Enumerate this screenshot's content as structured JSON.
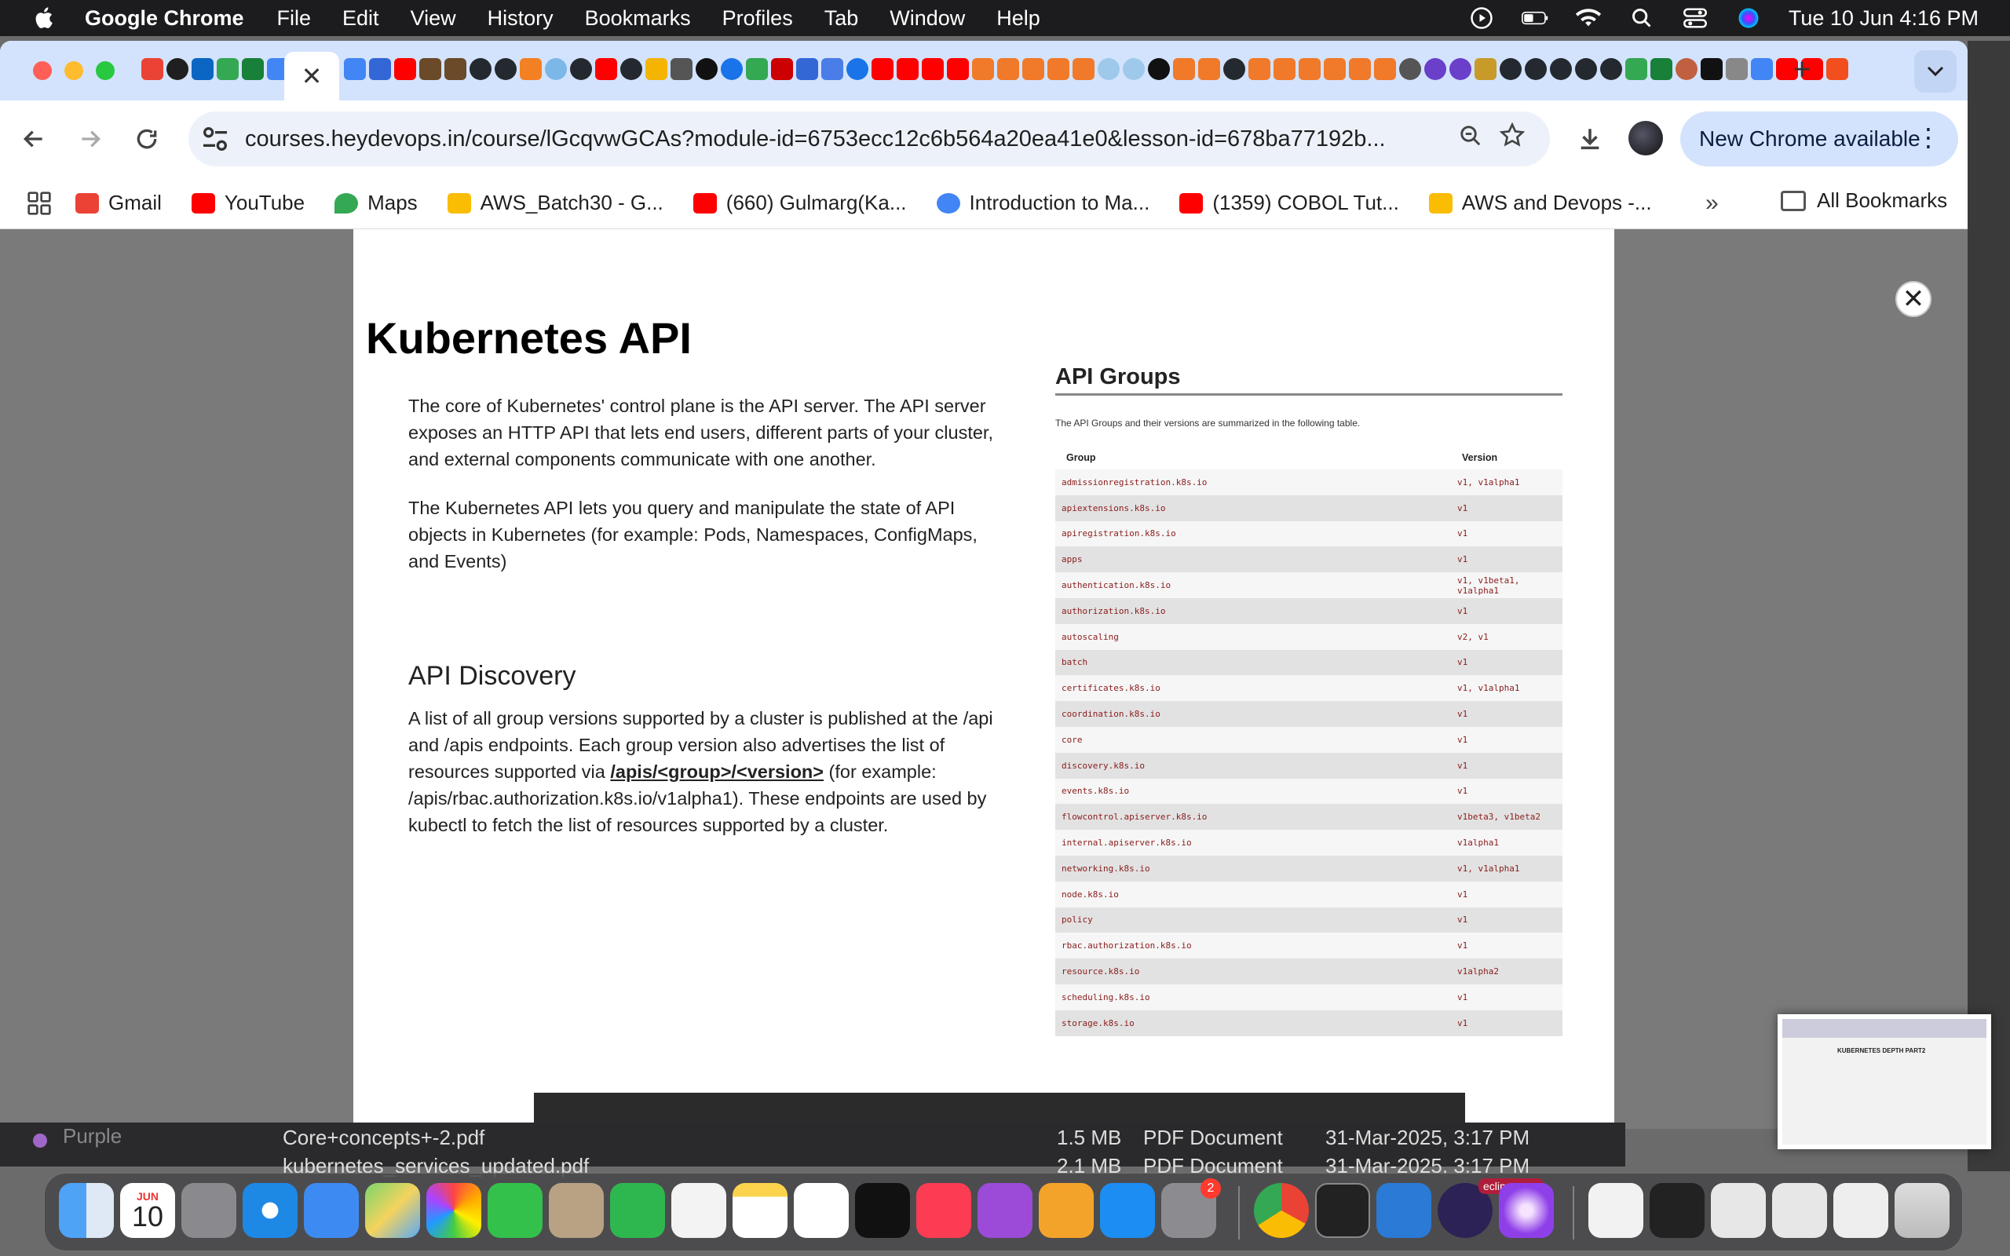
{
  "menubar": {
    "app_name": "Google Chrome",
    "items": [
      "File",
      "Edit",
      "View",
      "History",
      "Bookmarks",
      "Profiles",
      "Tab",
      "Window",
      "Help"
    ],
    "datetime": "Tue 10 Jun  4:16 PM"
  },
  "browser": {
    "active_tab_close": "✕",
    "new_tab": "+",
    "url": "courses.heydevops.in/course/lGcqvwGCAs?module-id=6753ecc12c6b564a20ea41e0&lesson-id=678ba77192b...",
    "update_label": "New Chrome available",
    "bookmarks": [
      {
        "label": "Gmail",
        "color": "#ea4335"
      },
      {
        "label": "YouTube",
        "color": "#ff0000"
      },
      {
        "label": "Maps",
        "color": "#34a853"
      },
      {
        "label": "AWS_Batch30 - G...",
        "color": "#fbbc04"
      },
      {
        "label": "(660) Gulmarg(Ka...",
        "color": "#ff0000"
      },
      {
        "label": "Introduction to Ma...",
        "color": "#4285f4"
      },
      {
        "label": "(1359) COBOL Tut...",
        "color": "#ff0000"
      },
      {
        "label": "AWS and Devops -...",
        "color": "#fbbc04"
      }
    ],
    "all_bookmarks": "All Bookmarks",
    "overflow": "»"
  },
  "slide": {
    "title": "Kubernetes API",
    "p1": "The core of Kubernetes' control plane is the API server. The API server exposes an HTTP API that lets end users, different parts of your cluster, and external components communicate with one another.",
    "p2": "The Kubernetes API lets you query and manipulate the state of API objects in Kubernetes (for example: Pods, Namespaces, ConfigMaps, and Events)",
    "discovery_heading": "API Discovery",
    "p3_before": "A list of all group versions supported by a cluster is published at the /api and /apis endpoints. Each group version also advertises the list of resources supported via ",
    "p3_link": "/apis/<group>/<version>",
    "p3_after": " (for example: /apis/rbac.authorization.k8s.io/v1alpha1). These endpoints are used by kubectl to fetch the list of resources supported by a cluster.",
    "api_groups": {
      "title": "API Groups",
      "intro": "The API Groups and their versions are summarized in the following table.",
      "headers": [
        "Group",
        "Version"
      ],
      "rows": [
        [
          "admissionregistration.k8s.io",
          "v1, v1alpha1"
        ],
        [
          "apiextensions.k8s.io",
          "v1"
        ],
        [
          "apiregistration.k8s.io",
          "v1"
        ],
        [
          "apps",
          "v1"
        ],
        [
          "authentication.k8s.io",
          "v1, v1beta1, v1alpha1"
        ],
        [
          "authorization.k8s.io",
          "v1"
        ],
        [
          "autoscaling",
          "v2, v1"
        ],
        [
          "batch",
          "v1"
        ],
        [
          "certificates.k8s.io",
          "v1, v1alpha1"
        ],
        [
          "coordination.k8s.io",
          "v1"
        ],
        [
          "core",
          "v1"
        ],
        [
          "discovery.k8s.io",
          "v1"
        ],
        [
          "events.k8s.io",
          "v1"
        ],
        [
          "flowcontrol.apiserver.k8s.io",
          "v1beta3, v1beta2"
        ],
        [
          "internal.apiserver.k8s.io",
          "v1alpha1"
        ],
        [
          "networking.k8s.io",
          "v1, v1alpha1"
        ],
        [
          "node.k8s.io",
          "v1"
        ],
        [
          "policy",
          "v1"
        ],
        [
          "rbac.authorization.k8s.io",
          "v1"
        ],
        [
          "resource.k8s.io",
          "v1alpha2"
        ],
        [
          "scheduling.k8s.io",
          "v1"
        ],
        [
          "storage.k8s.io",
          "v1"
        ]
      ]
    },
    "close": "✕"
  },
  "finder": {
    "tag": "Purple",
    "file1": {
      "name": "Core+concepts+-2.pdf",
      "size": "1.5 MB",
      "kind": "PDF Document",
      "date": "31-Mar-2025, 3:17 PM"
    },
    "file2": {
      "name": "kubernetes_services_updated.pdf",
      "size": "2.1 MB",
      "kind": "PDF Document",
      "date": "31-Mar-2025, 3:17 PM"
    }
  },
  "pip": {
    "title": "KUBERNETES DEPTH PART2"
  },
  "dock": {
    "calendar_month": "JUN",
    "calendar_day": "10",
    "settings_badge": "2",
    "eclipse_label": "eclip...pace"
  }
}
